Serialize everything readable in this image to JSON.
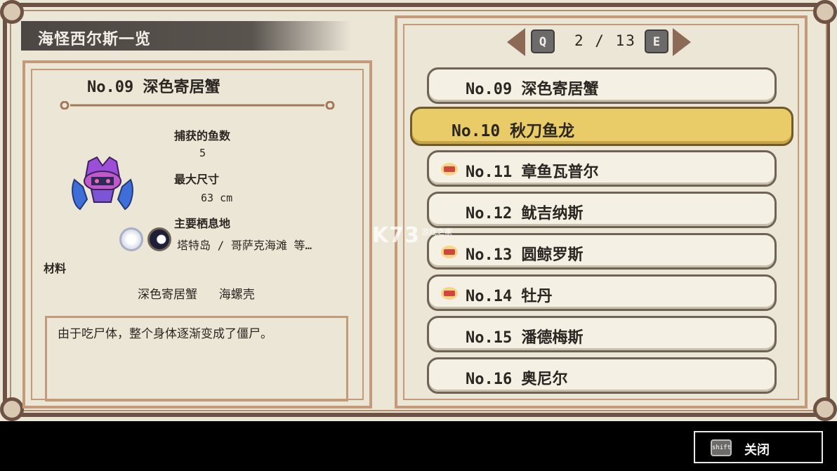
{
  "title": "海怪西尔斯一览",
  "detail": {
    "name": "No.09 深色寄居蟹",
    "caught_label": "捕获的鱼数",
    "caught_value": "5",
    "max_size_label": "最大尺寸",
    "max_size_value": "63 cm",
    "habitat_label": "主要栖息地",
    "habitat_value": "塔特岛 / 哥萨克海滩 等…",
    "materials_label": "材料",
    "materials_value": "深色寄居蟹   海螺壳",
    "description": "由于吃尸体，整个身体逐渐变成了僵尸。",
    "monster_icon": "purple-crab-monster-icon",
    "habitat_icons": [
      "moon-white-icon",
      "moon-dark-icon"
    ]
  },
  "pager": {
    "prev_key": "Q",
    "next_key": "E",
    "current": "2",
    "total": "13",
    "text": "2 / 13"
  },
  "list": [
    {
      "label": "No.09 深色寄居蟹",
      "selected": false,
      "badge": false
    },
    {
      "label": "No.10 秋刀鱼龙",
      "selected": true,
      "badge": false
    },
    {
      "label": "No.11 章鱼瓦普尔",
      "selected": false,
      "badge": true
    },
    {
      "label": "No.12 鱿吉纳斯",
      "selected": false,
      "badge": false
    },
    {
      "label": "No.13 圆鲸罗斯",
      "selected": false,
      "badge": true
    },
    {
      "label": "No.14 牡丹",
      "selected": false,
      "badge": true
    },
    {
      "label": "No.15 潘德梅斯",
      "selected": false,
      "badge": false
    },
    {
      "label": "No.16 奥尼尔",
      "selected": false,
      "badge": false
    }
  ],
  "watermark": {
    "main": "K73",
    "sub": "游戏之家"
  },
  "footer": {
    "close_key": "shift",
    "close_label": "关闭"
  },
  "colors": {
    "panel_bg": "#ece6d7",
    "frame_brown": "#6e5344",
    "frame_light": "#c39b7a",
    "selected_row": "#e9cc67",
    "row_bg": "#f4f0e4"
  }
}
